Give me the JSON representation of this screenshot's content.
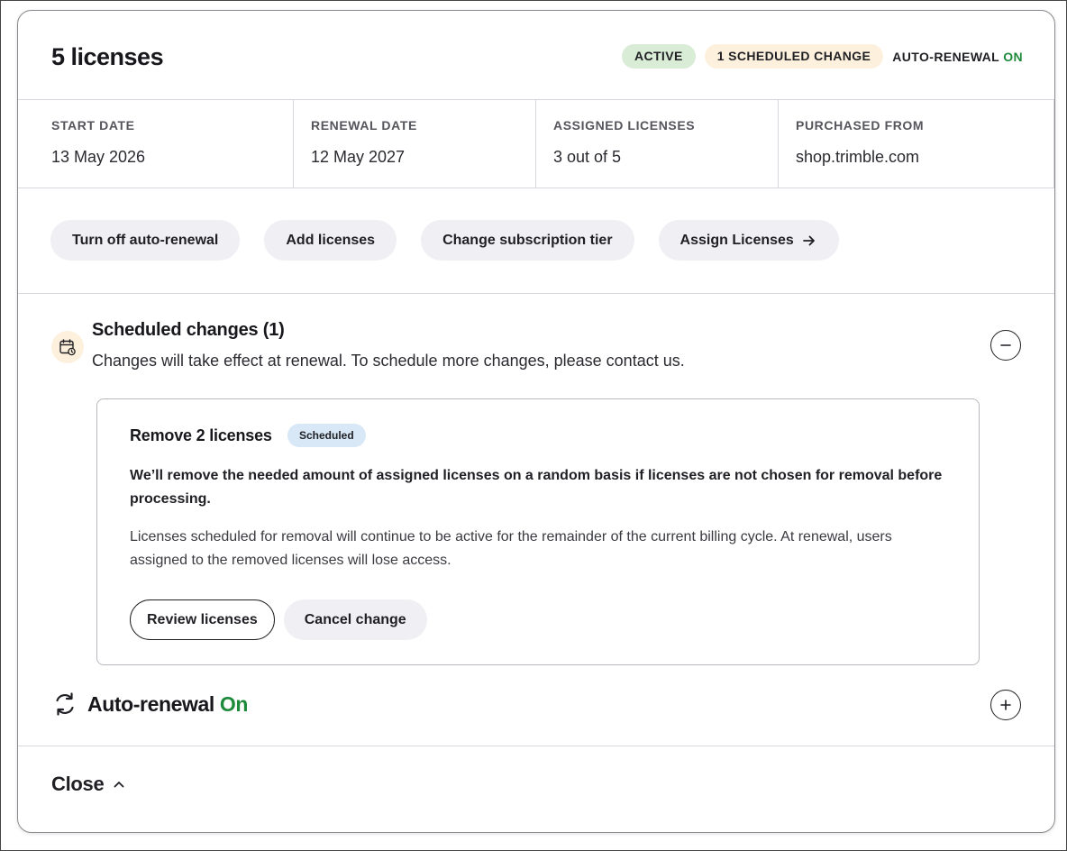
{
  "header": {
    "title": "5 licenses",
    "badge_active": "ACTIVE",
    "badge_scheduled": "1 SCHEDULED CHANGE",
    "auto_renewal_label": "AUTO-RENEWAL",
    "auto_renewal_state": "ON"
  },
  "info": {
    "start_label": "START DATE",
    "start_value": "13 May 2026",
    "renewal_label": "RENEWAL DATE",
    "renewal_value": "12 May 2027",
    "assigned_label": "ASSIGNED LICENSES",
    "assigned_value": "3 out of 5",
    "purchased_label": "PURCHASED FROM",
    "purchased_value": "shop.trimble.com"
  },
  "actions": {
    "turn_off": "Turn off auto-renewal",
    "add": "Add licenses",
    "change_tier": "Change subscription tier",
    "assign": "Assign Licenses"
  },
  "scheduled": {
    "title": "Scheduled changes (1)",
    "description": "Changes will take effect at renewal. To schedule more changes, please contact us.",
    "change": {
      "title": "Remove 2 licenses",
      "badge": "Scheduled",
      "bold_text": "We’ll remove the needed amount of assigned licenses on a random basis if licenses are not chosen for removal before processing.",
      "text": "Licenses scheduled for removal will continue to be active for the remainder of the current billing cycle. At renewal, users assigned to the removed licenses will lose access.",
      "review_label": "Review licenses",
      "cancel_label": "Cancel change"
    }
  },
  "auto_renewal": {
    "title": "Auto-renewal",
    "state": "On"
  },
  "footer": {
    "close_label": "Close"
  },
  "icons": {
    "calendar": "calendar-clock-icon",
    "collapse": "minus-circle-icon",
    "expand": "plus-circle-icon",
    "renew": "refresh-icon",
    "arrow": "arrow-right-icon",
    "chevron": "chevron-up-icon"
  },
  "colors": {
    "accent_green": "#1e8a3c",
    "active_badge_bg": "#d9ecd6",
    "scheduled_badge_bg": "#fdf0dd",
    "scheduled_pill_bg": "#d8e8f6",
    "button_bg": "#f0f0f4"
  }
}
